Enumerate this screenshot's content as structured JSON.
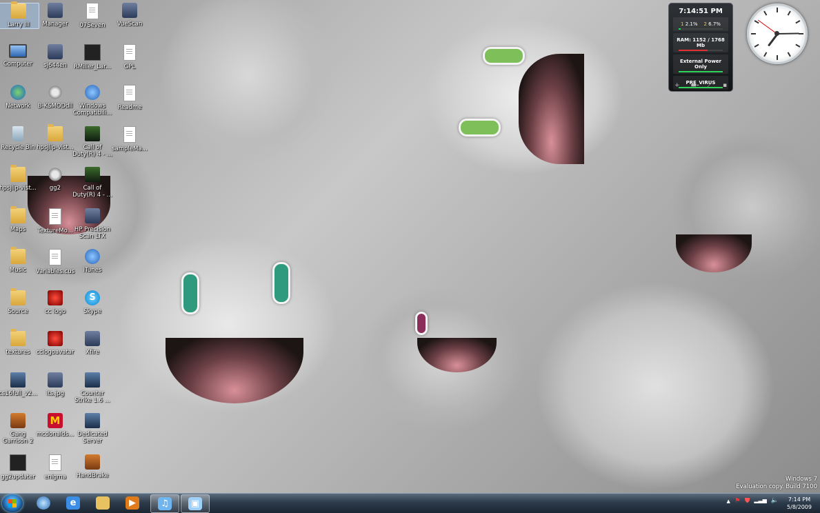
{
  "desktop_icons": [
    {
      "label": "Larry III",
      "type": "folder-user"
    },
    {
      "label": "Manager",
      "type": "app"
    },
    {
      "label": "07Seven",
      "type": "doc"
    },
    {
      "label": "VueScan",
      "type": "app"
    },
    {
      "label": "Computer",
      "type": "computer"
    },
    {
      "label": "sj644en",
      "type": "app"
    },
    {
      "label": "RMiller_Lar...",
      "type": "dark"
    },
    {
      "label": "GPL",
      "type": "doc"
    },
    {
      "label": "Network",
      "type": "network"
    },
    {
      "label": "B-KSMODdll",
      "type": "gear"
    },
    {
      "label": "Windows Compatibili...",
      "type": "blue"
    },
    {
      "label": "Readme",
      "type": "doc"
    },
    {
      "label": "Recycle Bin",
      "type": "recycle"
    },
    {
      "label": "hpsjlip-vist...",
      "type": "folder"
    },
    {
      "label": "Call of Duty(R) 4 - ...",
      "type": "green"
    },
    {
      "label": "sampleMa...",
      "type": "doc"
    },
    {
      "label": "hpsjlip-vist...",
      "type": "folder"
    },
    {
      "label": "gg2",
      "type": "gear"
    },
    {
      "label": "Call of Duty(R) 4 - ...",
      "type": "green"
    },
    {
      "label": "Maps",
      "type": "folder"
    },
    {
      "label": "TextureMo...",
      "type": "doc"
    },
    {
      "label": "HP Precision Scan LTX",
      "type": "app"
    },
    {
      "label": "Music",
      "type": "folder"
    },
    {
      "label": "Variables.cus",
      "type": "doc"
    },
    {
      "label": "iTunes",
      "type": "blue"
    },
    {
      "label": "Source",
      "type": "folder"
    },
    {
      "label": "cc logo",
      "type": "red"
    },
    {
      "label": "Skype",
      "type": "skype"
    },
    {
      "label": "textures",
      "type": "folder"
    },
    {
      "label": "cclogoavatar",
      "type": "red"
    },
    {
      "label": "Xfire",
      "type": "app"
    },
    {
      "label": "cs16full_v2...",
      "type": "cs"
    },
    {
      "label": "lts.jpg",
      "type": "app"
    },
    {
      "label": "Counter Strike 1.6 ...",
      "type": "cs"
    },
    {
      "label": "Gang Garrison 2",
      "type": "orange"
    },
    {
      "label": "mcdonalds...",
      "type": "mcd"
    },
    {
      "label": "Dedicated Server",
      "type": "cs"
    },
    {
      "label": "gg2updater",
      "type": "dark"
    },
    {
      "label": "enigma",
      "type": "doc"
    },
    {
      "label": "HandBrake",
      "type": "orange"
    }
  ],
  "cpu_gadget": {
    "time": "7:14:51 PM",
    "cpu1_label": "1",
    "cpu1_value": "2.1%",
    "cpu2_label": "2",
    "cpu2_value": "6.7%",
    "cpu1_level": 0.021,
    "cpu2_level": 0.067,
    "ram": "RAM: 1152 / 1768 Mb",
    "ram_level": 0.65,
    "power": "External Power Only",
    "network": "PRE_VIRUS",
    "tools": [
      "+",
      "▬",
      "⟋",
      "▪"
    ]
  },
  "clock": {
    "hour": 7,
    "minute": 14,
    "second": 51
  },
  "watermark": {
    "line1": "Windows 7",
    "line2": "Evaluation copy. Build 7100"
  },
  "taskbar": {
    "items": [
      {
        "name": "internet-explorer-icon",
        "symbol": "e",
        "active": false
      },
      {
        "name": "folder-icon",
        "symbol": "",
        "active": false
      },
      {
        "name": "media-player-icon",
        "symbol": "▶",
        "active": false
      },
      {
        "name": "itunes-icon",
        "symbol": "♫",
        "active": true
      },
      {
        "name": "remote-desktop-icon",
        "symbol": "▣",
        "active": true
      }
    ],
    "tray_icons": [
      "▲",
      "⚑",
      "⛊",
      "▂▃▅",
      "🔈"
    ],
    "time": "7:14 PM",
    "date": "5/8/2009"
  },
  "colors": {
    "taskbar": "#2d3b4a",
    "gadget_green": "#2fd35a",
    "gadget_red": "#e33030",
    "gadget_yellow": "#f2c94c"
  }
}
